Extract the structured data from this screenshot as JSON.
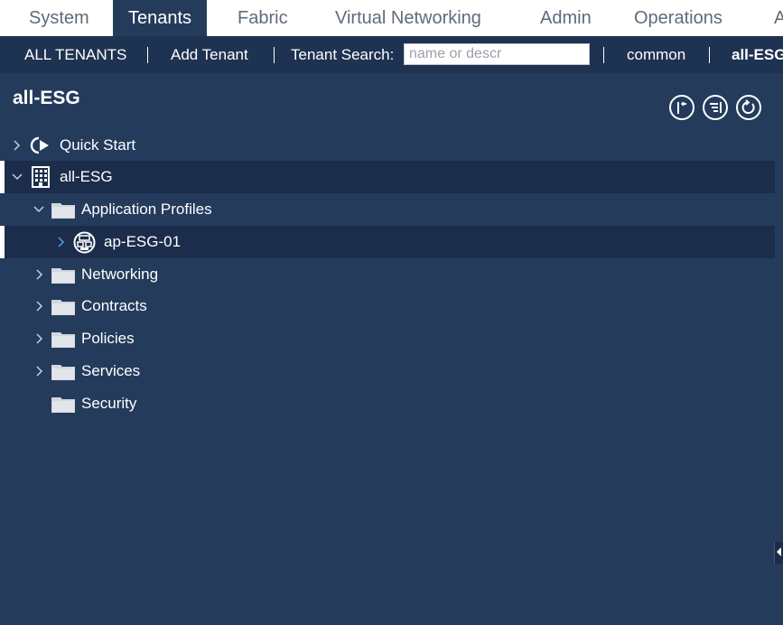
{
  "top_tabs": [
    {
      "label": "System"
    },
    {
      "label": "Tenants",
      "active": true
    },
    {
      "label": "Fabric"
    },
    {
      "label": "Virtual Networking"
    },
    {
      "label": "Admin"
    },
    {
      "label": "Operations"
    },
    {
      "label": "A"
    }
  ],
  "subnav": {
    "all_tenants": "ALL TENANTS",
    "add_tenant": "Add Tenant",
    "search_label": "Tenant Search:",
    "search_placeholder": "name or descr",
    "search_value": "",
    "recent_1": "common",
    "recent_2": "all-ESG"
  },
  "panel": {
    "title": "all-ESG",
    "tools": [
      "collapse-icon",
      "filter-list-icon",
      "refresh-icon"
    ]
  },
  "tree": {
    "quick_start": "Quick Start",
    "tenant": "all-ESG",
    "app_profiles": "Application Profiles",
    "ap_item": "ap-ESG-01",
    "networking": "Networking",
    "contracts": "Contracts",
    "policies": "Policies",
    "services": "Services",
    "security": "Security"
  },
  "colors": {
    "background": "#243b5c",
    "subnav": "#1e3251",
    "selected_row": "#1b2d4b",
    "tab_text": "#5f6b7a",
    "folder": "#d3d6dc",
    "chevron_accent": "#4aa3df"
  }
}
